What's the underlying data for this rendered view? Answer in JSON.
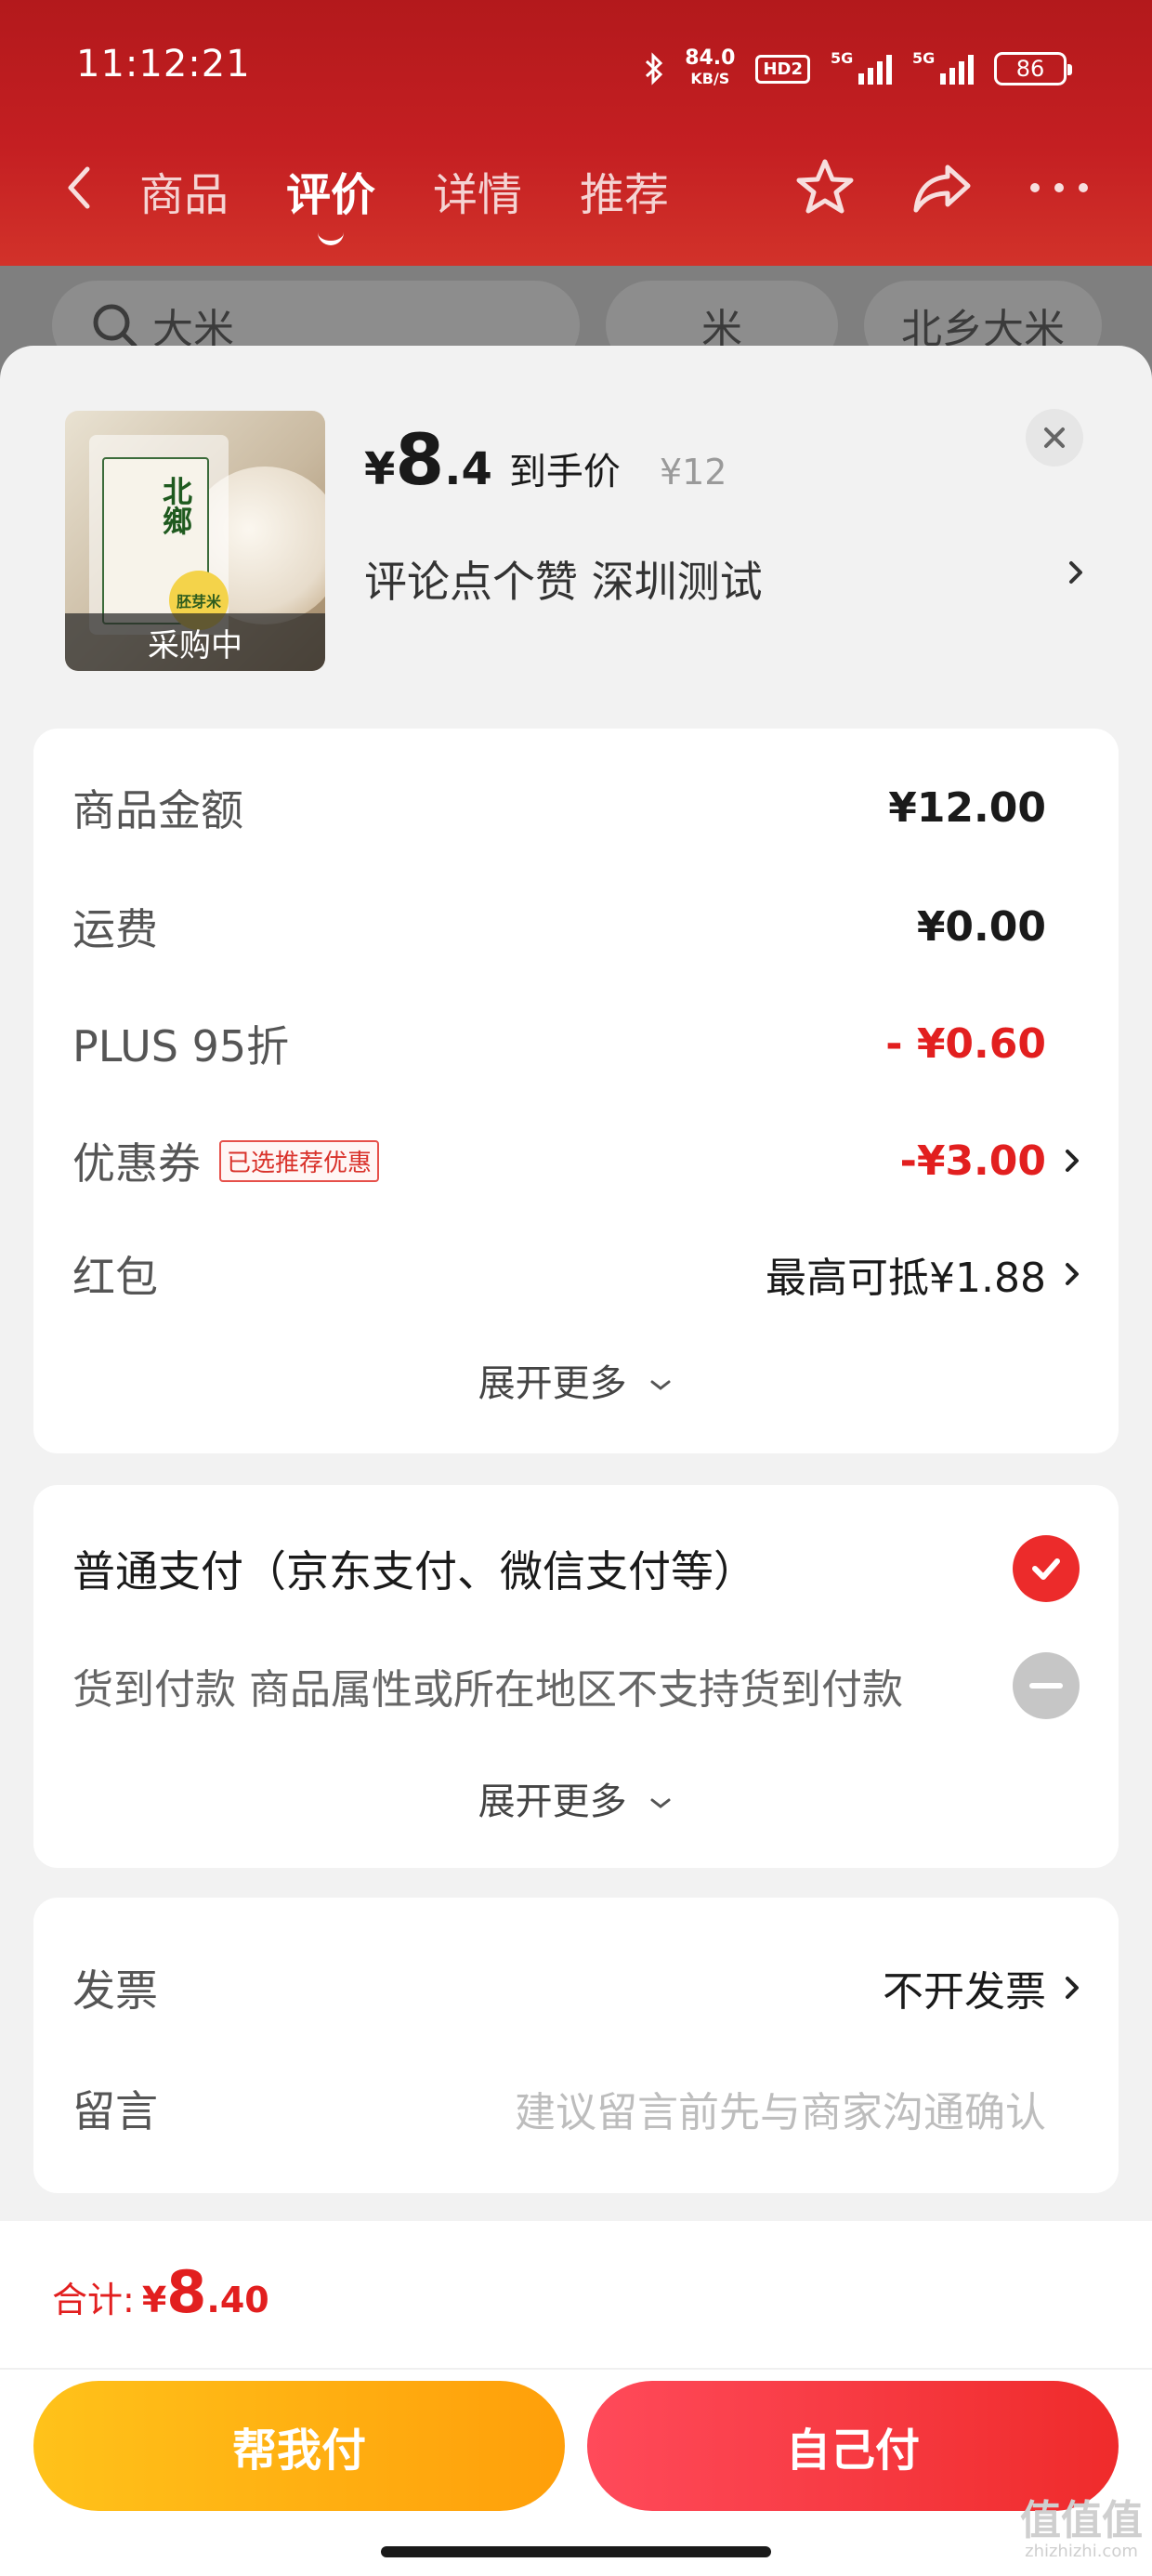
{
  "status_bar": {
    "time": "11:12:21",
    "net_speed_value": "84.0",
    "net_speed_unit": "KB/S",
    "hd_label": "HD2",
    "sim1_label": "5G",
    "sim2_label": "5G",
    "battery": "86"
  },
  "nav": {
    "tabs": [
      "商品",
      "评价",
      "详情",
      "推荐"
    ],
    "active_tab": "评价"
  },
  "filters": {
    "search_text": "大米",
    "chips": [
      "米",
      "北乡大米"
    ]
  },
  "product": {
    "thumb_caption": "采购中",
    "thumb_brand": "北鄉",
    "thumb_tag": "胚芽米",
    "price_symbol": "¥",
    "price_int": "8",
    "price_dec": ".4",
    "price_label": "到手价",
    "original_price": "¥12",
    "shop_text": "评论点个赞  深圳测试"
  },
  "summary": {
    "rows": [
      {
        "label": "商品金额",
        "value": "¥12.00"
      },
      {
        "label": "运费",
        "value": "¥0.00"
      },
      {
        "label": "PLUS 95折",
        "value": "- ¥0.60"
      },
      {
        "label": "优惠券",
        "tag": "已选推荐优惠",
        "value": "-¥3.00"
      },
      {
        "label": "红包",
        "value": "最高可抵¥1.88"
      }
    ],
    "expand_label": "展开更多"
  },
  "payment": {
    "option_normal": "普通支付（京东支付、微信支付等）",
    "option_cod": "货到付款 商品属性或所在地区不支持货到付款",
    "expand_label": "展开更多"
  },
  "extras": {
    "invoice_label": "发票",
    "invoice_value": "不开发票",
    "note_label": "留言",
    "note_placeholder": "建议留言前先与商家沟通确认"
  },
  "footer": {
    "total_label": "合计:",
    "total_symbol": "¥",
    "total_int": "8",
    "total_dec": ".40",
    "help_pay_label": "帮我付",
    "self_pay_label": "自己付"
  },
  "watermark": {
    "text": "值值值",
    "site": "zhizhizhi.com"
  },
  "colors": {
    "accent_red": "#e21f1f",
    "header_red": "#c41f22",
    "help_button": "#ffb011",
    "self_button": "#f0322f"
  }
}
